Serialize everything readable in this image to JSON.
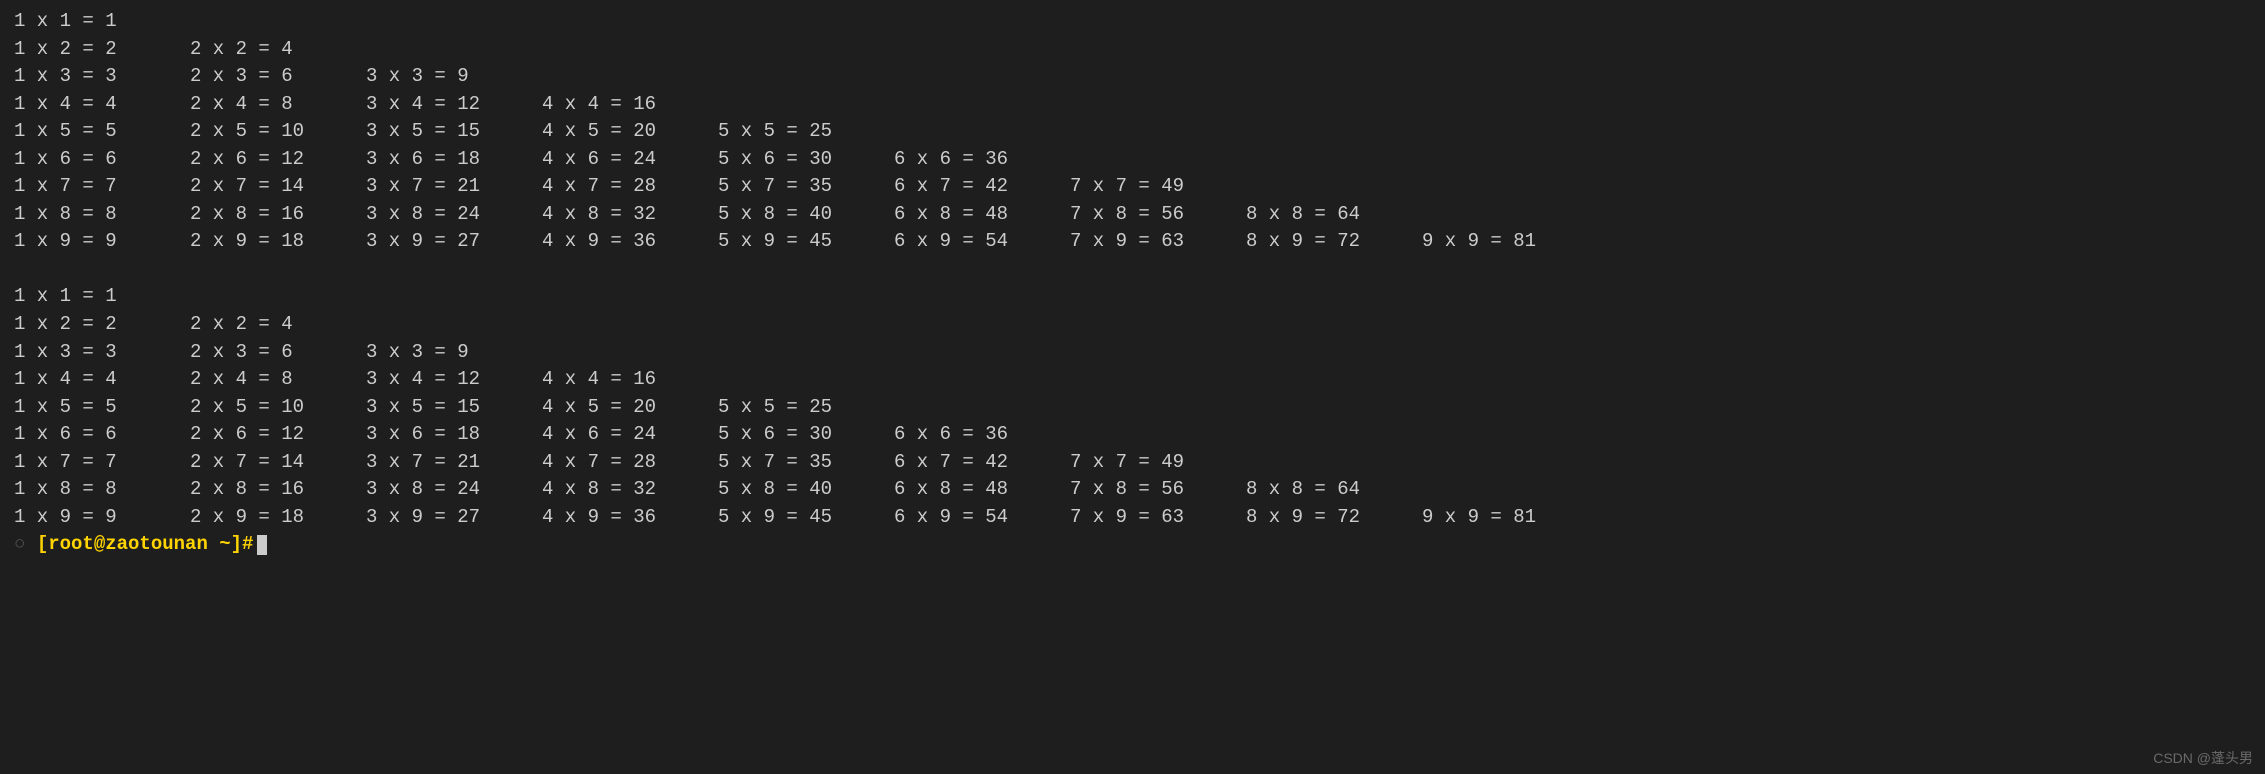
{
  "tables": [
    {
      "rows": [
        [
          "1 x 1 = 1"
        ],
        [
          "1 x 2 = 2",
          "2 x 2 = 4"
        ],
        [
          "1 x 3 = 3",
          "2 x 3 = 6",
          "3 x 3 = 9"
        ],
        [
          "1 x 4 = 4",
          "2 x 4 = 8",
          "3 x 4 = 12",
          "4 x 4 = 16"
        ],
        [
          "1 x 5 = 5",
          "2 x 5 = 10",
          "3 x 5 = 15",
          "4 x 5 = 20",
          "5 x 5 = 25"
        ],
        [
          "1 x 6 = 6",
          "2 x 6 = 12",
          "3 x 6 = 18",
          "4 x 6 = 24",
          "5 x 6 = 30",
          "6 x 6 = 36"
        ],
        [
          "1 x 7 = 7",
          "2 x 7 = 14",
          "3 x 7 = 21",
          "4 x 7 = 28",
          "5 x 7 = 35",
          "6 x 7 = 42",
          "7 x 7 = 49"
        ],
        [
          "1 x 8 = 8",
          "2 x 8 = 16",
          "3 x 8 = 24",
          "4 x 8 = 32",
          "5 x 8 = 40",
          "6 x 8 = 48",
          "7 x 8 = 56",
          "8 x 8 = 64"
        ],
        [
          "1 x 9 = 9",
          "2 x 9 = 18",
          "3 x 9 = 27",
          "4 x 9 = 36",
          "5 x 9 = 45",
          "6 x 9 = 54",
          "7 x 9 = 63",
          "8 x 9 = 72",
          "9 x 9 = 81"
        ]
      ]
    },
    {
      "rows": [
        [
          "1 x 1 = 1"
        ],
        [
          "1 x 2 = 2",
          "2 x 2 = 4"
        ],
        [
          "1 x 3 = 3",
          "2 x 3 = 6",
          "3 x 3 = 9"
        ],
        [
          "1 x 4 = 4",
          "2 x 4 = 8",
          "3 x 4 = 12",
          "4 x 4 = 16"
        ],
        [
          "1 x 5 = 5",
          "2 x 5 = 10",
          "3 x 5 = 15",
          "4 x 5 = 20",
          "5 x 5 = 25"
        ],
        [
          "1 x 6 = 6",
          "2 x 6 = 12",
          "3 x 6 = 18",
          "4 x 6 = 24",
          "5 x 6 = 30",
          "6 x 6 = 36"
        ],
        [
          "1 x 7 = 7",
          "2 x 7 = 14",
          "3 x 7 = 21",
          "4 x 7 = 28",
          "5 x 7 = 35",
          "6 x 7 = 42",
          "7 x 7 = 49"
        ],
        [
          "1 x 8 = 8",
          "2 x 8 = 16",
          "3 x 8 = 24",
          "4 x 8 = 32",
          "5 x 8 = 40",
          "6 x 8 = 48",
          "7 x 8 = 56",
          "8 x 8 = 64"
        ],
        [
          "1 x 9 = 9",
          "2 x 9 = 18",
          "3 x 9 = 27",
          "4 x 9 = 36",
          "5 x 9 = 45",
          "6 x 9 = 54",
          "7 x 9 = 63",
          "8 x 9 = 72",
          "9 x 9 = 81"
        ]
      ]
    }
  ],
  "prompt": {
    "arrow": "○",
    "user_host": "[root@zaotounan ",
    "path": "~",
    "suffix": "]#"
  },
  "watermark": "CSDN @蓬头男"
}
